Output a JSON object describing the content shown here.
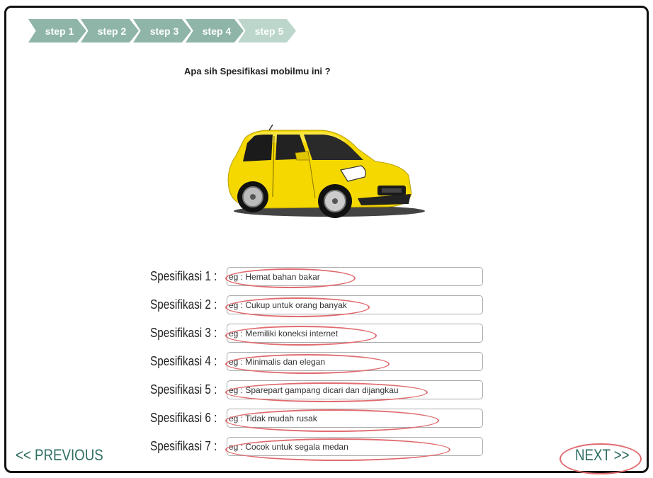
{
  "steps": [
    "step 1",
    "step 2",
    "step 3",
    "step 4",
    "step 5"
  ],
  "question": "Apa sih Spesifikasi mobilmu ini ?",
  "car_icon": "car-icon",
  "rows": [
    {
      "label": "Spesifikasi 1 :",
      "placeholder": "eg : Hemat bahan bakar"
    },
    {
      "label": "Spesifikasi 2 :",
      "placeholder": "eg : Cukup untuk orang banyak"
    },
    {
      "label": "Spesifikasi 3 :",
      "placeholder": "eg : Memiliki koneksi internet"
    },
    {
      "label": "Spesifikasi 4 :",
      "placeholder": "eg : Minimalis dan elegan"
    },
    {
      "label": "Spesifikasi 5 :",
      "placeholder": "eg : Sparepart gampang dicari dan dijangkau"
    },
    {
      "label": "Spesifikasi 6 :",
      "placeholder": "eg : Tidak mudah rusak"
    },
    {
      "label": "Spesifikasi 7 :",
      "placeholder": "eg : Cocok untuk segala medan"
    }
  ],
  "nav": {
    "previous": "<< PREVIOUS",
    "next": "NEXT >>"
  },
  "colors": {
    "step": "#8fb5a8",
    "step_active": "#bcd6cc",
    "nav": "#2e6e62",
    "annotation": "#e06b6f",
    "car": "#f5d800"
  }
}
